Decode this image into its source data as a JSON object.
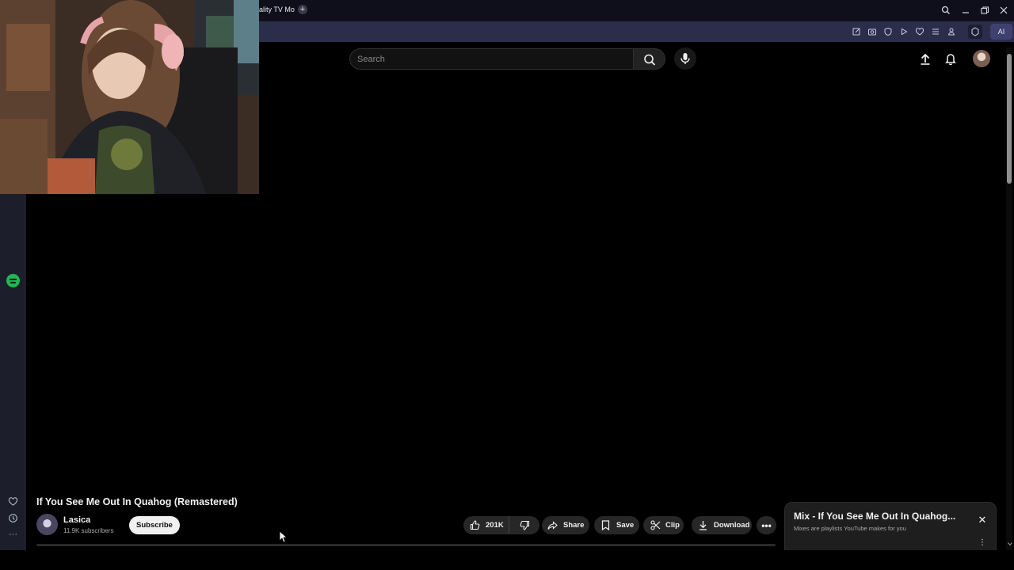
{
  "browser": {
    "tab_title": "ality TV Mo",
    "new_tab_symbol": "+",
    "ai_label": "AI",
    "window_controls": [
      "search-icon",
      "minimize-icon",
      "restore-icon",
      "close-icon"
    ],
    "toolbar_icons": [
      "edit-icon",
      "camera-icon",
      "shield-icon",
      "play-icon",
      "heart-icon",
      "menu-icon",
      "user-icon",
      "extension-icon"
    ]
  },
  "header": {
    "search_placeholder": "Search",
    "icons": [
      "search-icon",
      "mic-icon",
      "upload-icon",
      "bell-icon",
      "avatar"
    ]
  },
  "sidebar": {
    "items": [
      "spotify-icon",
      "heart-icon",
      "history-icon",
      "more-icon"
    ],
    "more_symbol": "···"
  },
  "video": {
    "title": "If You See Me Out In Quahog (Remastered)",
    "channel": "Lasica",
    "subscribers": "11.9K subscribers",
    "subscribe_label": "Subscribe",
    "likes": "201K",
    "share_label": "Share",
    "save_label": "Save",
    "clip_label": "Clip",
    "download_label": "Download",
    "more_symbol": "•••"
  },
  "mix": {
    "title": "Mix - If You See Me Out In Quahog...",
    "subtitle": "Mixes are playlists YouTube makes for you",
    "close_symbol": "✕",
    "more_symbol": "⋮"
  },
  "colors": {
    "background": "#000000",
    "titlebar": "#0e0f1a",
    "addressbar": "#2b2e4a",
    "sidebar": "#1c1f2b",
    "spotify": "#1db954",
    "pill": "#272727"
  }
}
